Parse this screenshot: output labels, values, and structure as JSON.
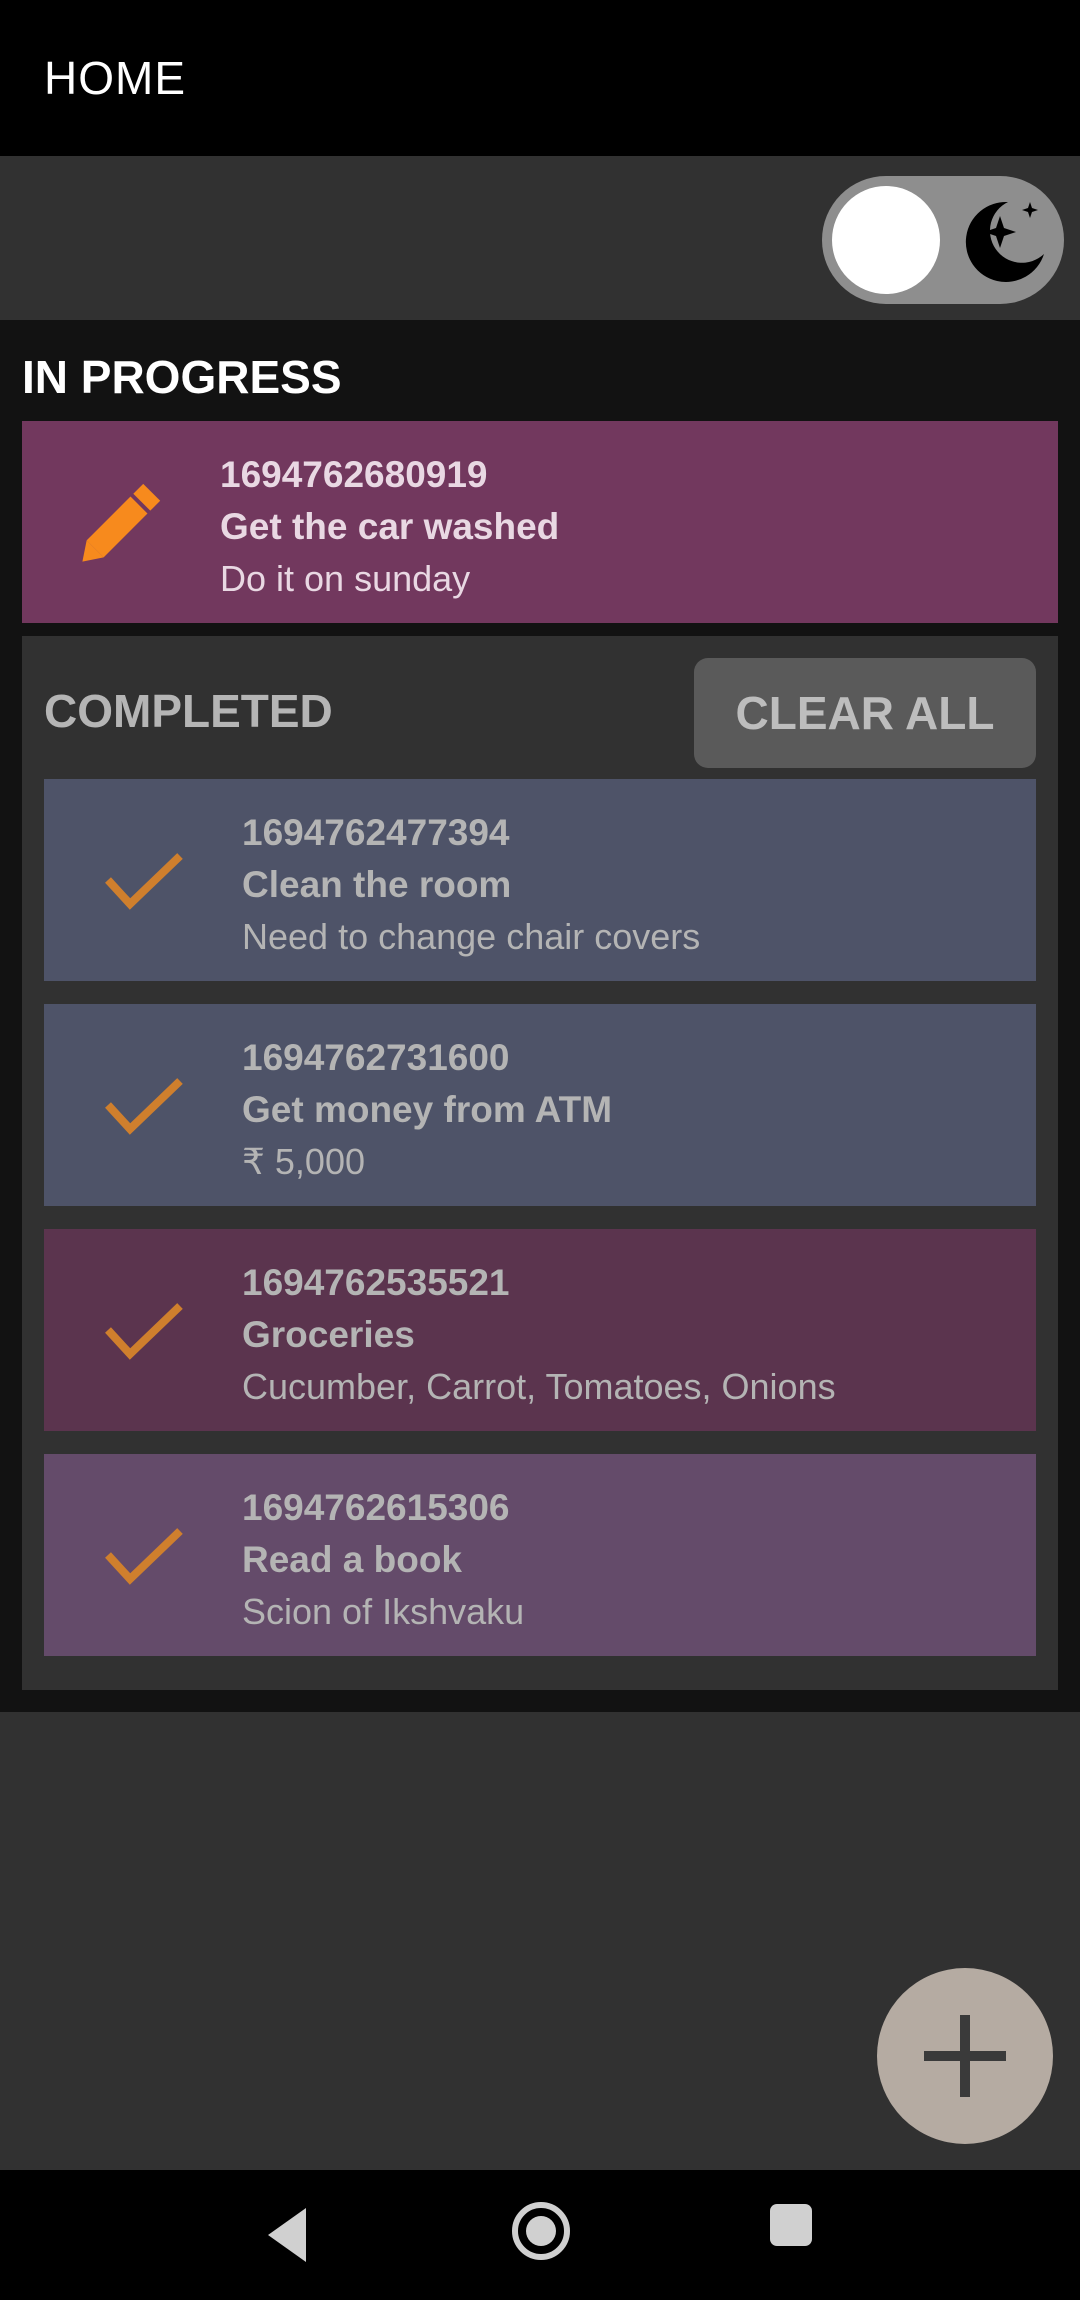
{
  "appbar": {
    "title": "HOME"
  },
  "theme_toggle": {
    "icon": "moon-icon",
    "state": "dark"
  },
  "in_progress": {
    "title": "IN PROGRESS",
    "items": [
      {
        "id": "1694762680919",
        "title": "Get the car washed",
        "note": "Do it on sunday",
        "icon": "pencil-icon",
        "color": "#72385e"
      }
    ]
  },
  "completed": {
    "title": "COMPLETED",
    "clear_label": "CLEAR ALL",
    "items": [
      {
        "id": "1694762477394",
        "title": "Clean the room",
        "note": "Need to change chair covers",
        "icon": "check-icon",
        "color": "#4e5368"
      },
      {
        "id": "1694762731600",
        "title": "Get money from ATM",
        "note": "₹ 5,000",
        "icon": "check-icon",
        "color": "#4e5368"
      },
      {
        "id": "1694762535521",
        "title": "Groceries",
        "note": "Cucumber, Carrot, Tomatoes, Onions",
        "icon": "check-icon",
        "color": "#5b344e"
      },
      {
        "id": "1694762615306",
        "title": "Read a book",
        "note": "Scion of Ikshvaku",
        "icon": "check-icon",
        "color": "#644b6a"
      }
    ]
  },
  "fab": {
    "icon": "plus-icon"
  },
  "colors": {
    "accent": "#f78a1d",
    "check": "#cf7f2d",
    "background": "#313131",
    "list_background": "#121212"
  }
}
